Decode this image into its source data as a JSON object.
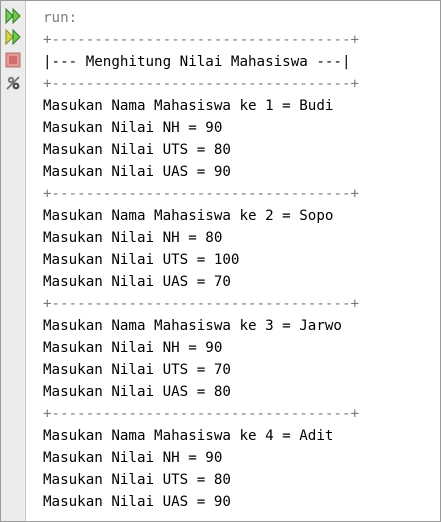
{
  "toolbar": {
    "icons": [
      "rerun-icon",
      "rerun-with-options-icon",
      "stop-icon",
      "settings-icon"
    ]
  },
  "console": {
    "run_label": "run:",
    "border_line": "+-----------------------------------+",
    "title_line": "|--- Menghitung Nilai Mahasiswa ---|",
    "lines": [
      "Masukan Nama Mahasiswa ke 1 = Budi",
      "Masukan Nilai NH = 90",
      "Masukan Nilai UTS = 80",
      "Masukan Nilai UAS = 90",
      "+-----------------------------------+",
      "Masukan Nama Mahasiswa ke 2 = Sopo",
      "Masukan Nilai NH = 80",
      "Masukan Nilai UTS = 100",
      "Masukan Nilai UAS = 70",
      "+-----------------------------------+",
      "Masukan Nama Mahasiswa ke 3 = Jarwo",
      "Masukan Nilai NH = 90",
      "Masukan Nilai UTS = 70",
      "Masukan Nilai UAS = 80",
      "+-----------------------------------+",
      "Masukan Nama Mahasiswa ke 4 = Adit",
      "Masukan Nilai NH = 90",
      "Masukan Nilai UTS = 80",
      "Masukan Nilai UAS = 90"
    ]
  },
  "colors": {
    "text": "#000000",
    "muted": "#7d7d7d",
    "toolbar_bg": "#ececec",
    "rerun_green": "#3c9a2d",
    "stop_red": "#c84040"
  }
}
